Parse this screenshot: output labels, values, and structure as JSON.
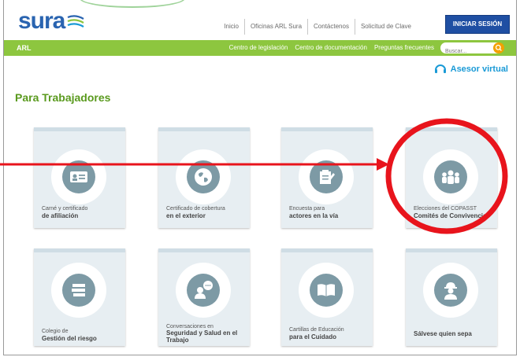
{
  "brand": {
    "logo_text": "sura"
  },
  "top_nav": {
    "items": [
      "Inicio",
      "Oficinas ARL Sura",
      "Contáctenos",
      "Solicitud de Clave"
    ],
    "login": "INICIAR SESIÓN"
  },
  "green_bar": {
    "section": "ARL",
    "links": [
      "Centro de legislación",
      "Centro de documentación",
      "Preguntas frecuentes"
    ],
    "search_placeholder": "Buscar..."
  },
  "assistant": {
    "label": "Asesor virtual"
  },
  "page": {
    "title": "Para Trabajadores"
  },
  "cards": [
    {
      "line1": "Carné y certificado",
      "line2": "de afiliación",
      "icon": "id-card-icon"
    },
    {
      "line1": "Certificado de cobertura",
      "line2": "en el exterior",
      "icon": "globe-icon"
    },
    {
      "line1": "Encuesta para",
      "line2": "actores en la vía",
      "icon": "survey-icon"
    },
    {
      "line1": "Elecciones del COPASST",
      "line2": "Comités de Convivencia",
      "icon": "group-icon"
    },
    {
      "line1": "Colegio de",
      "line2": "Gestión del riesgo",
      "icon": "books-icon"
    },
    {
      "line1": "Conversaciones en",
      "line2": "Seguridad y Salud en el Trabajo",
      "icon": "conversation-icon"
    },
    {
      "line1": "Cartillas de Educación",
      "line2": "para el Cuidado",
      "icon": "open-book-icon"
    },
    {
      "line1": "",
      "line2": "Sálvese quien sepa",
      "icon": "worker-helmet-icon"
    }
  ],
  "colors": {
    "brand_blue": "#2a64b0",
    "green": "#8dc63f",
    "annotation_red": "#e8141c",
    "icon_grey": "#7d9aa5"
  }
}
